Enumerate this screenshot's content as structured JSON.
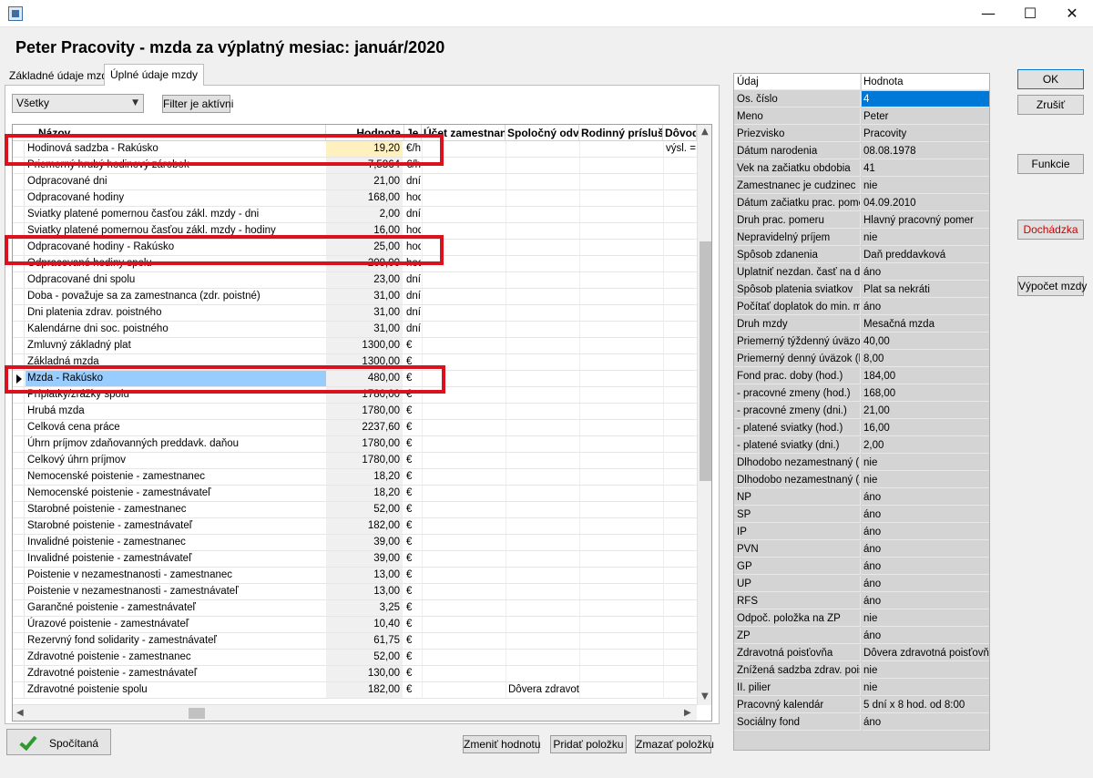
{
  "window": {
    "minimize_glyph": "—",
    "maximize_glyph": "☐",
    "close_glyph": "✕"
  },
  "heading": "Peter Pracovity - mzda za výplatný mesiac: január/2020",
  "tabs": [
    "Základné údaje mzdy",
    "Úplné údaje mzdy"
  ],
  "filter": {
    "combo_value": "Všetky",
    "combo_arrow": "▼",
    "filter_button": "Filter je aktívni"
  },
  "grid": {
    "columns": [
      "Názov",
      "Hodnota",
      "Je",
      "Účet zamestnan",
      "Spoločný odv",
      "Rodinný prísluš",
      "Dôvod"
    ],
    "rows": [
      {
        "name": "Hodinová sadzba - Rakúsko",
        "value": "19,20",
        "unit": "€/ho",
        "spol": "",
        "dov": "výsl. ="
      },
      {
        "name": "Priemerný hrubý hodinový zárobok",
        "value": "7,5864",
        "unit": "€/ho",
        "spol": "",
        "dov": ""
      },
      {
        "name": "Odpracované dni",
        "value": "21,00",
        "unit": "dní",
        "spol": "",
        "dov": ""
      },
      {
        "name": "Odpracované hodiny",
        "value": "168,00",
        "unit": "hod",
        "spol": "",
        "dov": ""
      },
      {
        "name": "Sviatky platené pomernou časťou zákl. mzdy - dni",
        "value": "2,00",
        "unit": "dní",
        "spol": "",
        "dov": ""
      },
      {
        "name": "Sviatky platené pomernou časťou zákl. mzdy - hodiny",
        "value": "16,00",
        "unit": "hod",
        "spol": "",
        "dov": ""
      },
      {
        "name": "Odpracované hodiny - Rakúsko",
        "value": "25,00",
        "unit": "hod",
        "spol": "",
        "dov": ""
      },
      {
        "name": "Odpracované hodiny spolu",
        "value": "209,00",
        "unit": "hod",
        "spol": "",
        "dov": ""
      },
      {
        "name": "Odpracované dni spolu",
        "value": "23,00",
        "unit": "dní",
        "spol": "",
        "dov": ""
      },
      {
        "name": "Doba - považuje sa za zamestnanca (zdr. poistné)",
        "value": "31,00",
        "unit": "dní",
        "spol": "",
        "dov": ""
      },
      {
        "name": "Dni platenia zdrav. poistného",
        "value": "31,00",
        "unit": "dní",
        "spol": "",
        "dov": ""
      },
      {
        "name": "Kalendárne dni soc. poistného",
        "value": "31,00",
        "unit": "dní",
        "spol": "",
        "dov": ""
      },
      {
        "name": "Zmluvný základný plat",
        "value": "1300,00",
        "unit": "€",
        "spol": "",
        "dov": ""
      },
      {
        "name": "Základná mzda",
        "value": "1300,00",
        "unit": "€",
        "spol": "",
        "dov": ""
      },
      {
        "name": "Mzda - Rakúsko",
        "value": "480,00",
        "unit": "€",
        "spol": "",
        "dov": ""
      },
      {
        "name": "Príplatky/zrážky spolu",
        "value": "1780,00",
        "unit": "€",
        "spol": "",
        "dov": ""
      },
      {
        "name": "Hrubá mzda",
        "value": "1780,00",
        "unit": "€",
        "spol": "",
        "dov": ""
      },
      {
        "name": "Celková cena práce",
        "value": "2237,60",
        "unit": "€",
        "spol": "",
        "dov": ""
      },
      {
        "name": "Úhrn príjmov zdaňovanných preddavk. daňou",
        "value": "1780,00",
        "unit": "€",
        "spol": "",
        "dov": ""
      },
      {
        "name": "Celkový úhrn príjmov",
        "value": "1780,00",
        "unit": "€",
        "spol": "",
        "dov": ""
      },
      {
        "name": "Nemocenské poistenie - zamestnanec",
        "value": "18,20",
        "unit": "€",
        "spol": "",
        "dov": ""
      },
      {
        "name": "Nemocenské poistenie - zamestnávateľ",
        "value": "18,20",
        "unit": "€",
        "spol": "",
        "dov": ""
      },
      {
        "name": "Starobné poistenie - zamestnanec",
        "value": "52,00",
        "unit": "€",
        "spol": "",
        "dov": ""
      },
      {
        "name": "Starobné poistenie - zamestnávateľ",
        "value": "182,00",
        "unit": "€",
        "spol": "",
        "dov": ""
      },
      {
        "name": "Invalidné poistenie - zamestnanec",
        "value": "39,00",
        "unit": "€",
        "spol": "",
        "dov": ""
      },
      {
        "name": "Invalidné poistenie - zamestnávateľ",
        "value": "39,00",
        "unit": "€",
        "spol": "",
        "dov": ""
      },
      {
        "name": "Poistenie v nezamestnanosti - zamestnanec",
        "value": "13,00",
        "unit": "€",
        "spol": "",
        "dov": ""
      },
      {
        "name": "Poistenie v nezamestnanosti - zamestnávateľ",
        "value": "13,00",
        "unit": "€",
        "spol": "",
        "dov": ""
      },
      {
        "name": "Garančné poistenie - zamestnávateľ",
        "value": "3,25",
        "unit": "€",
        "spol": "",
        "dov": ""
      },
      {
        "name": "Úrazové poistenie - zamestnávateľ",
        "value": "10,40",
        "unit": "€",
        "spol": "",
        "dov": ""
      },
      {
        "name": "Rezervný fond solidarity - zamestnávateľ",
        "value": "61,75",
        "unit": "€",
        "spol": "",
        "dov": ""
      },
      {
        "name": "Zdravotné poistenie - zamestnanec",
        "value": "52,00",
        "unit": "€",
        "spol": "",
        "dov": ""
      },
      {
        "name": "Zdravotné poistenie - zamestnávateľ",
        "value": "130,00",
        "unit": "€",
        "spol": "",
        "dov": ""
      },
      {
        "name": "Zdravotné poistenie spolu",
        "value": "182,00",
        "unit": "€",
        "spol": "Dôvera zdravotn",
        "dov": ""
      }
    ],
    "selected_row_index": 14,
    "editing_row_index": 0,
    "row_indicator": "▶",
    "scroll_up": "▲",
    "scroll_down": "▼",
    "scroll_left": "◀",
    "scroll_right": "▶"
  },
  "status_label": "Spočítaná",
  "bottom_buttons": {
    "change_value": "Zmeniť hodnotu",
    "add_item": "Pridať položku",
    "delete_item": "Zmazať položku"
  },
  "props": {
    "header": {
      "key": "Údaj",
      "value": "Hodnota"
    },
    "selected_index": 0,
    "rows": [
      {
        "key": "Os. číslo",
        "value": "4"
      },
      {
        "key": "Meno",
        "value": "Peter"
      },
      {
        "key": "Priezvisko",
        "value": "Pracovity"
      },
      {
        "key": "Dátum narodenia",
        "value": "08.08.1978"
      },
      {
        "key": "Vek na začiatku obdobia",
        "value": "41"
      },
      {
        "key": "Zamestnanec je cudzinec",
        "value": "nie"
      },
      {
        "key": "Dátum začiatku prac. pomeru",
        "value": "04.09.2010"
      },
      {
        "key": "Druh prac. pomeru",
        "value": "Hlavný pracovný pomer"
      },
      {
        "key": "Nepravidelný príjem",
        "value": "nie"
      },
      {
        "key": "Spôsob zdanenia",
        "value": "Daň preddavková"
      },
      {
        "key": "Uplatniť nezdan. časť na daň",
        "value": "áno"
      },
      {
        "key": "Spôsob platenia sviatkov",
        "value": "Plat sa nekráti"
      },
      {
        "key": "Počítať doplatok do min. mzdy",
        "value": "áno"
      },
      {
        "key": "Druh mzdy",
        "value": "Mesačná mzda"
      },
      {
        "key": "Priemerný týždenný úväzok (hod.)",
        "value": "40,00"
      },
      {
        "key": "Priemerný denný úväzok (hod.)",
        "value": "8,00"
      },
      {
        "key": "Fond prac. doby (hod.)",
        "value": "184,00"
      },
      {
        "key": " - pracovné zmeny (hod.)",
        "value": "168,00"
      },
      {
        "key": " - pracovné zmeny (dni.)",
        "value": "21,00"
      },
      {
        "key": " - platené sviatky (hod.)",
        "value": "16,00"
      },
      {
        "key": " - platené sviatky (dni.)",
        "value": "2,00"
      },
      {
        "key": "Dlhodobo nezamestnaný (SP)",
        "value": "nie"
      },
      {
        "key": "Dlhodobo nezamestnaný (ZP)",
        "value": "nie"
      },
      {
        "key": "NP",
        "value": "áno"
      },
      {
        "key": "SP",
        "value": "áno"
      },
      {
        "key": "IP",
        "value": "áno"
      },
      {
        "key": "PVN",
        "value": "áno"
      },
      {
        "key": "GP",
        "value": "áno"
      },
      {
        "key": "UP",
        "value": "áno"
      },
      {
        "key": "RFS",
        "value": "áno"
      },
      {
        "key": "Odpoč. položka na ZP",
        "value": "nie"
      },
      {
        "key": "ZP",
        "value": "áno"
      },
      {
        "key": "Zdravotná poisťovňa",
        "value": "Dôvera zdravotná poisťovňa"
      },
      {
        "key": "Znížená sadzba zdrav. poistného",
        "value": "nie"
      },
      {
        "key": "II. pilier",
        "value": "nie"
      },
      {
        "key": "Pracovný kalendár",
        "value": "5 dní x 8 hod. od 8:00"
      },
      {
        "key": "Sociálny fond",
        "value": "áno"
      }
    ]
  },
  "right_buttons": {
    "ok": "OK",
    "cancel": "Zrušiť",
    "functions": "Funkcie",
    "attendance": "Dochádzka",
    "calc": "Výpočet mzdy"
  },
  "colors": {
    "highlight_border": "#d9121e",
    "row_selection": "#99ccff",
    "prop_selection": "#0078d7",
    "status_check": "#2e9a2e"
  }
}
